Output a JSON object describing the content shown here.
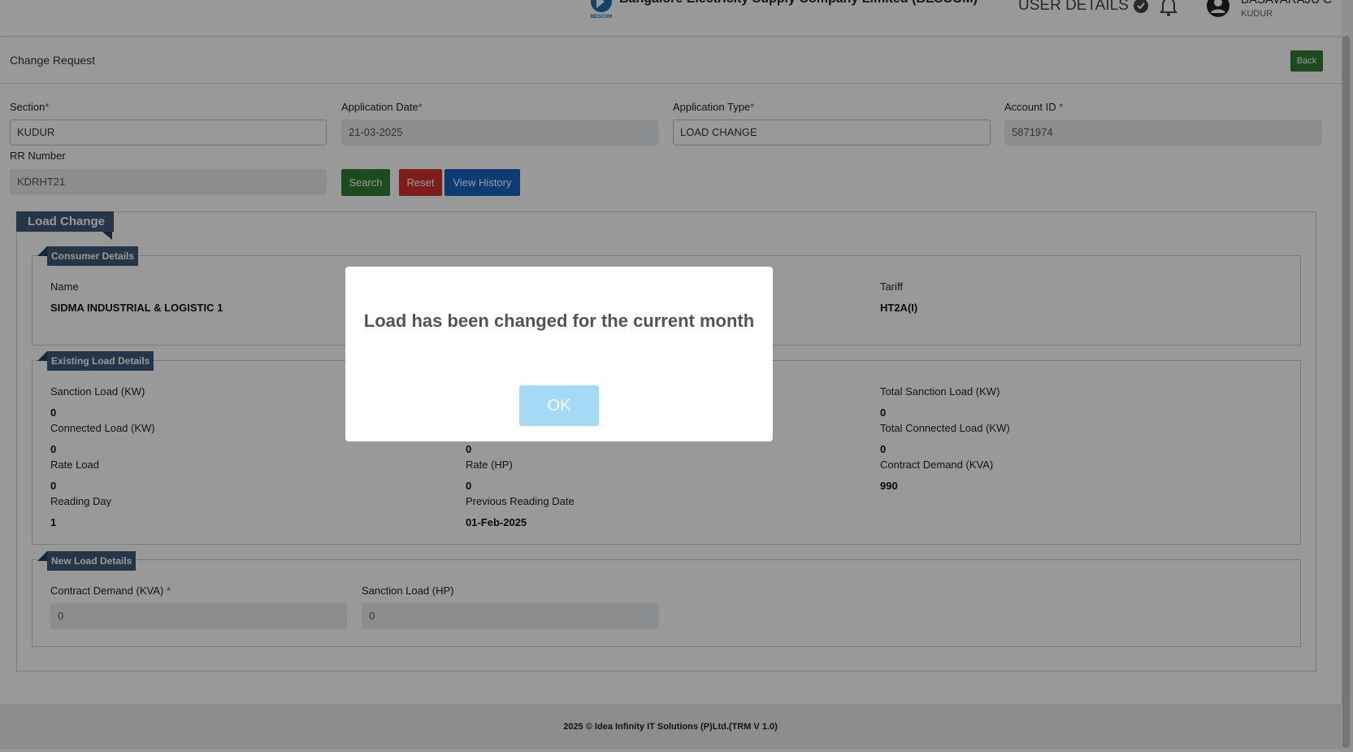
{
  "header": {
    "company_name": "Bangalore Electricity Supply Company Limited (BESCOM)",
    "logo_text": "BESCOM",
    "user_details_label": "USER DETAILS",
    "user_name": "BASAVARAJU C",
    "user_section": "KUDUR"
  },
  "page": {
    "title": "Change Request",
    "back_label": "Back"
  },
  "form": {
    "section_label": "Section",
    "section_value": "KUDUR",
    "application_date_label": "Application Date",
    "application_date_value": "21-03-2025",
    "application_type_label": "Application Type",
    "application_type_value": "LOAD CHANGE",
    "account_id_label": "Account ID",
    "account_id_value": "5871974",
    "rr_number_label": "RR Number",
    "rr_number_value": "KDRHT21",
    "required_mark": "*",
    "search_label": "Search",
    "reset_label": "Reset",
    "view_history_label": "View History"
  },
  "load_change": {
    "title": "Load Change",
    "consumer_details": {
      "title": "Consumer Details",
      "name_label": "Name",
      "name_value": "SIDMA INDUSTRIAL & LOGISTIC 1",
      "tariff_label": "Tariff",
      "tariff_value": "HT2A(I)"
    },
    "existing": {
      "title": "Existing Load Details",
      "sanction_load_kw_label": "Sanction Load (KW)",
      "sanction_load_kw_value": "0",
      "total_sanction_load_label": "Total Sanction Load (KW)",
      "total_sanction_load_value": "0",
      "connected_load_kw_label": "Connected Load (KW)",
      "connected_load_kw_value": "0",
      "col2_row2_value": "0",
      "total_connected_load_label": "Total Connected Load (KW)",
      "total_connected_load_value": "0",
      "rate_load_label": "Rate Load",
      "rate_load_value": "0",
      "rate_hp_label": "Rate (HP)",
      "rate_hp_value": "0",
      "contract_demand_label": "Contract Demand (KVA)",
      "contract_demand_value": "990",
      "reading_day_label": "Reading Day",
      "reading_day_value": "1",
      "prev_reading_date_label": "Previous Reading Date",
      "prev_reading_date_value": "01-Feb-2025"
    },
    "new_load": {
      "title": "New Load Details",
      "contract_demand_label": "Contract Demand (KVA)",
      "contract_demand_value": "0",
      "sanction_load_hp_label": "Sanction Load (HP)",
      "sanction_load_hp_value": "0"
    }
  },
  "footer": {
    "text": "2025 © Idea Infinity IT Solutions (P)Ltd.(TRM V 1.0)"
  },
  "modal": {
    "message": "Load has been changed for the current month",
    "ok_label": "OK"
  },
  "colors": {
    "legend_bg": "#3c5a78",
    "search_btn": "#2e7d32",
    "reset_btn": "#d32f2f",
    "history_btn": "#1565c0",
    "ok_btn": "#a5d9f5"
  }
}
